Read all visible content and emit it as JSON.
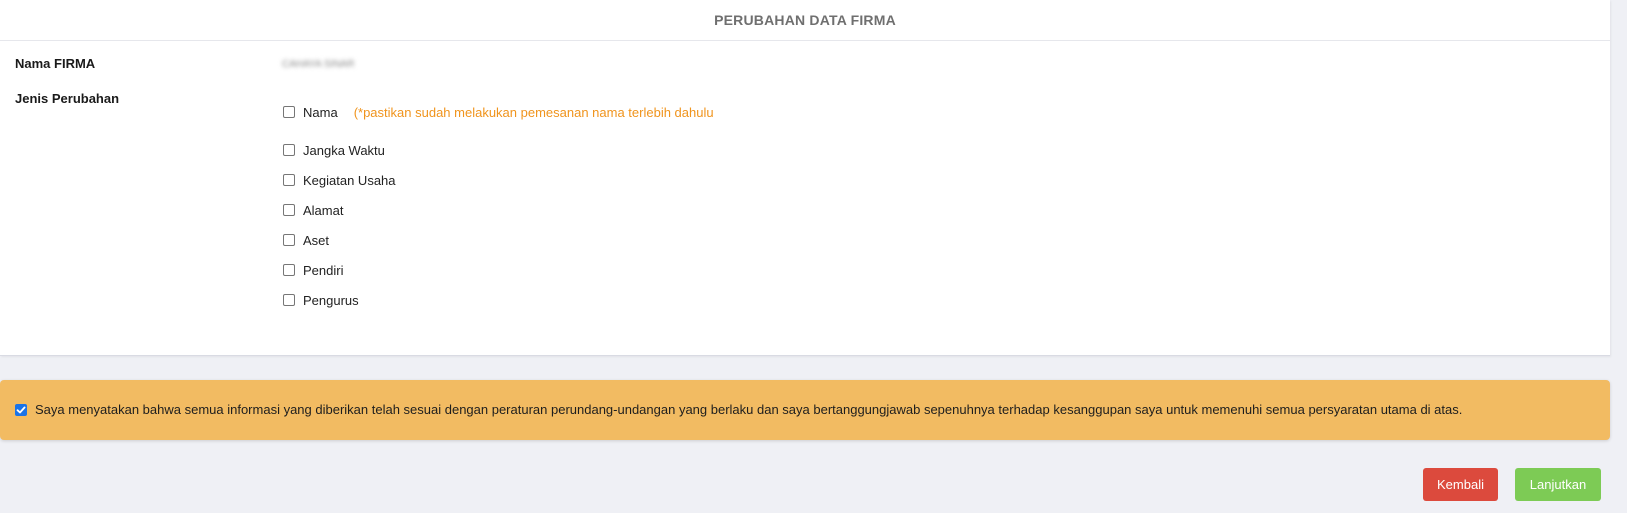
{
  "header": {
    "title": "PERUBAHAN DATA FIRMA"
  },
  "form": {
    "nama_label": "Nama FIRMA",
    "nama_value": "CAHAYA SINAR",
    "jenis_label": "Jenis Perubahan",
    "nama_note": "(*pastikan sudah melakukan pemesanan nama terlebih dahulu",
    "options": [
      {
        "label": "Nama",
        "checked": false
      },
      {
        "label": "Jangka Waktu",
        "checked": false
      },
      {
        "label": "Kegiatan Usaha",
        "checked": false
      },
      {
        "label": "Alamat",
        "checked": false
      },
      {
        "label": "Aset",
        "checked": false
      },
      {
        "label": "Pendiri",
        "checked": false
      },
      {
        "label": "Pengurus",
        "checked": false
      }
    ]
  },
  "agreement": {
    "checked": true,
    "text": "Saya menyatakan bahwa semua informasi yang diberikan telah sesuai dengan peraturan perundang-undangan yang berlaku dan saya bertanggungjawab sepenuhnya terhadap kesanggupan saya untuk memenuhi semua persyaratan utama di atas."
  },
  "buttons": {
    "back": "Kembali",
    "next": "Lanjutkan"
  },
  "colors": {
    "note": "#f0941d",
    "agreement_bg": "#f2bb62",
    "back_button": "#dc4a3d",
    "next_button": "#7dcb55",
    "checkbox_checked": "#1a73e8"
  }
}
